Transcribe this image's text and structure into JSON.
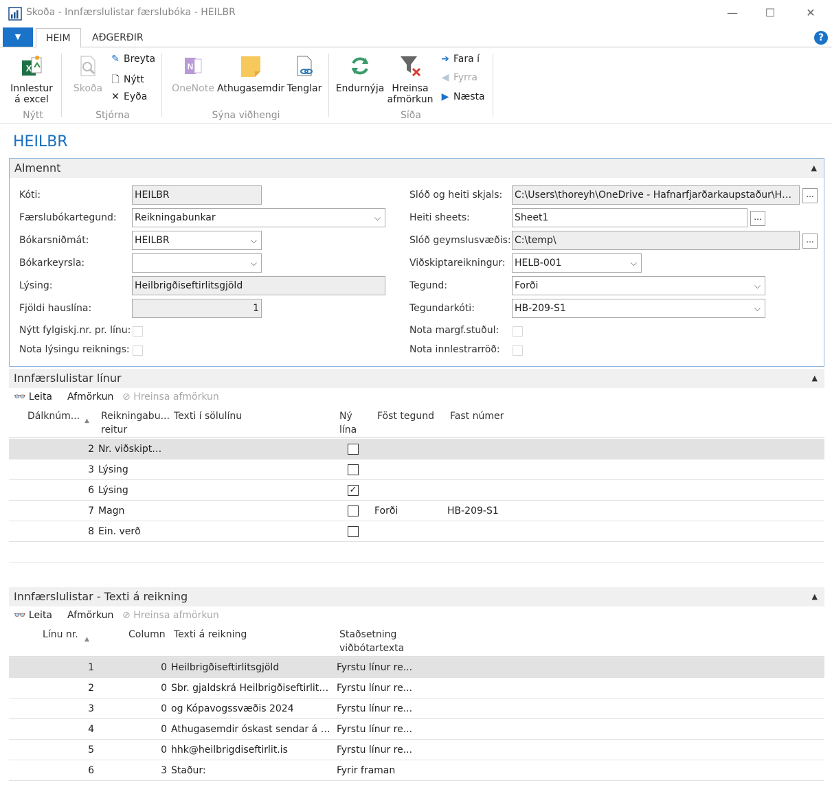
{
  "window": {
    "title": "Skoða - Innfærslulistar færslubóka - HEILBR",
    "minimize": "—",
    "maximize": "☐",
    "close": "✕"
  },
  "ribbon_tabs": [
    {
      "label": "HEIM",
      "active": true
    },
    {
      "label": "AÐGERÐIR",
      "active": false
    }
  ],
  "ribbon": {
    "nytt_group": {
      "label": "Nýtt",
      "import_excel": "Innlestur\ná excel"
    },
    "stjorna_group": {
      "label": "Stjórna",
      "skoda": "Skoða",
      "breyta": "Breyta",
      "nytt": "Nýtt",
      "eyda": "Eyða"
    },
    "syna_group": {
      "label": "Sýna viðhengi",
      "onenote": "OneNote",
      "athugasemdir": "Athugasemdir",
      "tenglar": "Tenglar"
    },
    "sida_group": {
      "label": "Síða",
      "endurnyja": "Endurnýja",
      "hreinsa": "Hreinsa\nafmörkun",
      "fara_i": "Fara í",
      "fyrra": "Fyrra",
      "naesta": "Næsta"
    }
  },
  "page_title": "HEILBR",
  "general": {
    "header": "Almennt",
    "koti": {
      "label": "Kóti:",
      "value": "HEILBR"
    },
    "faerslubokartegund": {
      "label": "Færslubókartegund:",
      "value": "Reikningabunkar"
    },
    "bokarsnidmat": {
      "label": "Bókarsniðmát:",
      "value": "HEILBR"
    },
    "bokarkeyrsla": {
      "label": "Bókarkeyrsla:",
      "value": ""
    },
    "lysing": {
      "label": "Lýsing:",
      "value": "Heilbrigðiseftirlitsgjöld"
    },
    "fjoldi_hauslina": {
      "label": "Fjöldi hauslína:",
      "value": "1"
    },
    "nytt_fylgiskj": {
      "label": "Nýtt fylgiskj.nr. pr. línu:",
      "checked": false
    },
    "nota_lysingu": {
      "label": "Nota lýsingu reiknings:",
      "checked": false
    },
    "slod_heiti": {
      "label": "Slóð og heiti skjals:",
      "value": "C:\\Users\\thoreyh\\OneDrive - Hafnarfjarðarkaupstaður\\Heilbri..."
    },
    "heiti_sheets": {
      "label": "Heiti sheets:",
      "value": "Sheet1"
    },
    "slod_geymslu": {
      "label": "Slóð geymslusvæðis:",
      "value": "C:\\temp\\"
    },
    "vidskiptareikningur": {
      "label": "Viðskiptareikningur:",
      "value": "HELB-001"
    },
    "tegund": {
      "label": "Tegund:",
      "value": "Forði"
    },
    "tegundarkoti": {
      "label": "Tegundarkóti:",
      "value": "HB-209-S1"
    },
    "nota_margf": {
      "label": "Nota margf.stuðul:",
      "checked": false
    },
    "nota_innlestr": {
      "label": "Nota innlestrarröð:",
      "checked": false
    },
    "dots": "..."
  },
  "lines": {
    "header": "Innfærslulistar línur",
    "toolbar": {
      "leita": "Leita",
      "afmorkun": "Afmörkun",
      "hreinsa": "Hreinsa afmörkun"
    },
    "columns": {
      "dalknum": "Dálknúm...",
      "reikningabu_1": "Reikningabu...",
      "reikningabu_2": "reitur",
      "texti": "Texti í sölulínu",
      "ny_1": "Ný",
      "ny_2": "lína",
      "fost": "Föst tegund",
      "fast": "Fast númer"
    },
    "rows": [
      {
        "num": "2",
        "field": "Nr. viðskipta...",
        "text": "",
        "new_line": false,
        "fixed_type": "",
        "fixed_no": "",
        "selected": true
      },
      {
        "num": "3",
        "field": "Lýsing",
        "text": "",
        "new_line": false,
        "fixed_type": "",
        "fixed_no": "",
        "selected": false
      },
      {
        "num": "6",
        "field": "Lýsing",
        "text": "",
        "new_line": true,
        "fixed_type": "",
        "fixed_no": "",
        "selected": false
      },
      {
        "num": "7",
        "field": "Magn",
        "text": "",
        "new_line": false,
        "fixed_type": "Forði",
        "fixed_no": "HB-209-S1",
        "selected": false
      },
      {
        "num": "8",
        "field": "Ein. verð",
        "text": "",
        "new_line": false,
        "fixed_type": "",
        "fixed_no": "",
        "selected": false
      }
    ]
  },
  "texts": {
    "header": "Innfærslulistar - Texti á reikning",
    "toolbar": {
      "leita": "Leita",
      "afmorkun": "Afmörkun",
      "hreinsa": "Hreinsa afmörkun"
    },
    "columns": {
      "linu_nr": "Línu nr.",
      "column": "Column",
      "texti": "Texti á reikning",
      "stadsetning_1": "Staðsetning",
      "stadsetning_2": "viðbótartexta"
    },
    "rows": [
      {
        "line": "1",
        "col": "0",
        "text": "Heilbrigðiseftirlitsgjöld",
        "pos": "Fyrstu línur re...",
        "selected": true
      },
      {
        "line": "2",
        "col": "0",
        "text": "Sbr. gjaldskrá Heilbrigðiseftirlits ...",
        "pos": "Fyrstu línur re...",
        "selected": false
      },
      {
        "line": "3",
        "col": "0",
        "text": "og Kópavogssvæðis 2024",
        "pos": "Fyrstu línur re...",
        "selected": false
      },
      {
        "line": "4",
        "col": "0",
        "text": "Athugasemdir óskast sendar á net...",
        "pos": "Fyrstu línur re...",
        "selected": false
      },
      {
        "line": "5",
        "col": "0",
        "text": "hhk@heilbrigdiseftirlit.is",
        "pos": "Fyrstu línur re...",
        "selected": false
      },
      {
        "line": "6",
        "col": "3",
        "text": "Staður:",
        "pos": "Fyrir framan",
        "selected": false
      }
    ]
  },
  "colors": {
    "accent": "#1a73c8",
    "title": "#1a6fbd",
    "selected_row": "#e2e2e2"
  }
}
